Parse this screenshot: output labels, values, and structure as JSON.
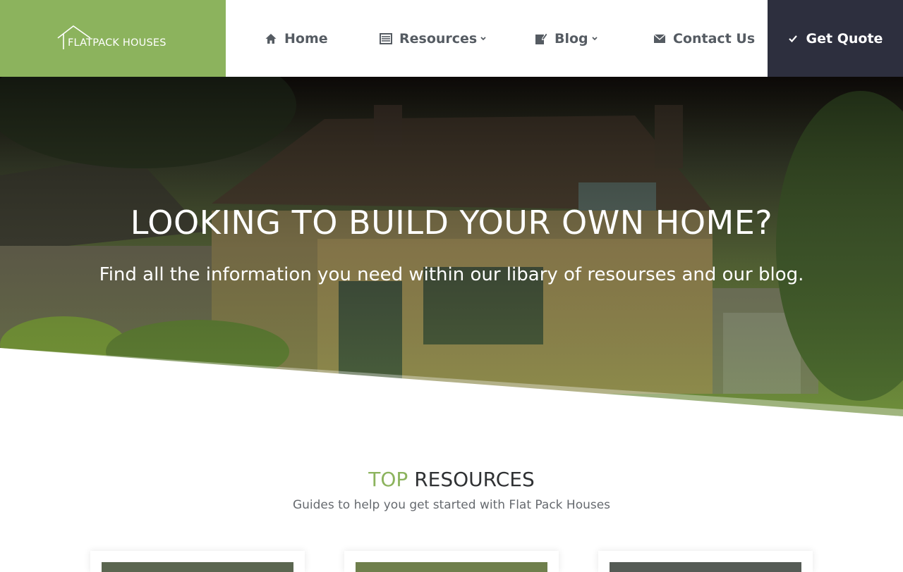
{
  "header": {
    "logo_text": "FLATPACK HOUSES",
    "nav": {
      "home": {
        "label": "Home",
        "icon": "home-icon"
      },
      "resources": {
        "label": "Resources",
        "icon": "list-icon"
      },
      "blog": {
        "label": "Blog",
        "icon": "edit-icon"
      },
      "contact": {
        "label": "Contact Us",
        "icon": "envelope-icon"
      }
    },
    "cta": {
      "label": "Get Quote",
      "icon": "check-icon"
    }
  },
  "hero": {
    "title": "LOOKING TO BUILD YOUR OWN HOME?",
    "subtitle": "Find all the information you need within our libary of resourses and our blog."
  },
  "resources": {
    "title_accent": "TOP",
    "title_rest": "RESOURCES",
    "subtitle": "Guides to help you get started with Flat Pack Houses",
    "cards": [
      {
        "name": "resource-card-1"
      },
      {
        "name": "resource-card-2"
      },
      {
        "name": "resource-card-3"
      }
    ]
  },
  "colors": {
    "brand_green": "#8cb35d",
    "dark_navy": "#2d2f3e",
    "nav_text": "#555b62"
  }
}
